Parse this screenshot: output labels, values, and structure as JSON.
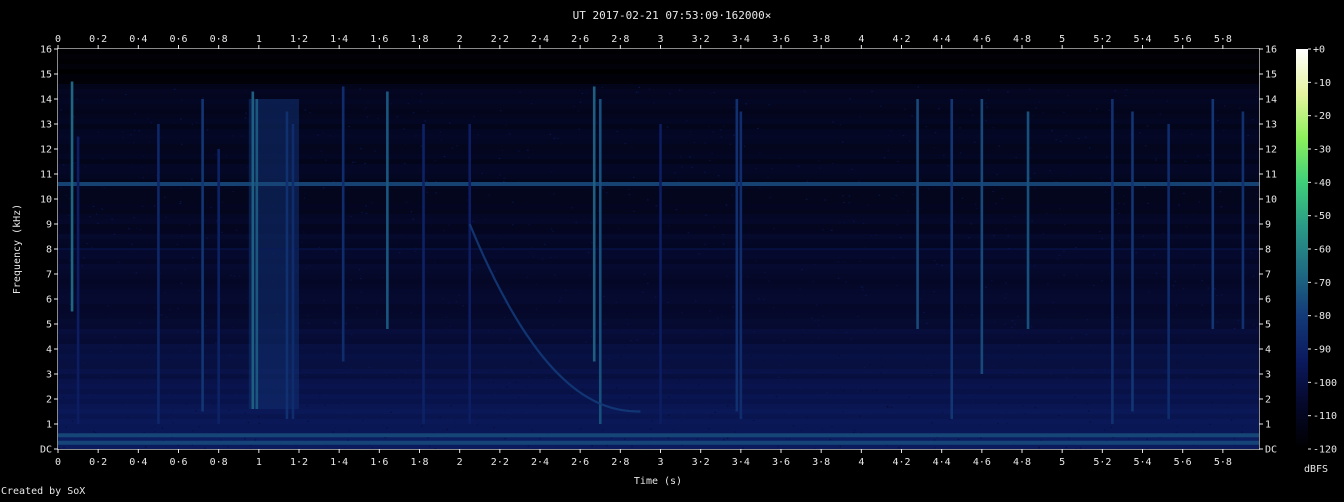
{
  "title": "UT 2017-02-21 07:53:09·162000×",
  "credit": "Created by SoX",
  "colors": {
    "background": "#000000",
    "text": "#e8e8e8",
    "frame": "#8a8a8a",
    "colormap": [
      "#000000",
      "#05082a",
      "#0b1a5e",
      "#133a78",
      "#1f6b82",
      "#2a9a86",
      "#3fd07a",
      "#8cf05c",
      "#e6f4a0",
      "#ffffff"
    ]
  },
  "chart_data": {
    "type": "heatmap",
    "title": "UT 2017-02-21 07:53:09·162000×",
    "xlabel": "Time (s)",
    "ylabel": "Frequency (kHz)",
    "xlim": [
      0,
      5.98
    ],
    "ylim": [
      0,
      16
    ],
    "x_ticks": [
      {
        "v": 0,
        "t": "0"
      },
      {
        "v": 0.2,
        "t": "0·2"
      },
      {
        "v": 0.4,
        "t": "0·4"
      },
      {
        "v": 0.6,
        "t": "0·6"
      },
      {
        "v": 0.8,
        "t": "0·8"
      },
      {
        "v": 1,
        "t": "1"
      },
      {
        "v": 1.2,
        "t": "1·2"
      },
      {
        "v": 1.4,
        "t": "1·4"
      },
      {
        "v": 1.6,
        "t": "1·6"
      },
      {
        "v": 1.8,
        "t": "1·8"
      },
      {
        "v": 2,
        "t": "2"
      },
      {
        "v": 2.2,
        "t": "2·2"
      },
      {
        "v": 2.4,
        "t": "2·4"
      },
      {
        "v": 2.6,
        "t": "2·6"
      },
      {
        "v": 2.8,
        "t": "2·8"
      },
      {
        "v": 3,
        "t": "3"
      },
      {
        "v": 3.2,
        "t": "3·2"
      },
      {
        "v": 3.4,
        "t": "3·4"
      },
      {
        "v": 3.6,
        "t": "3·6"
      },
      {
        "v": 3.8,
        "t": "3·8"
      },
      {
        "v": 4,
        "t": "4"
      },
      {
        "v": 4.2,
        "t": "4·2"
      },
      {
        "v": 4.4,
        "t": "4·4"
      },
      {
        "v": 4.6,
        "t": "4·6"
      },
      {
        "v": 4.8,
        "t": "4·8"
      },
      {
        "v": 5,
        "t": "5"
      },
      {
        "v": 5.2,
        "t": "5·2"
      },
      {
        "v": 5.4,
        "t": "5·4"
      },
      {
        "v": 5.6,
        "t": "5·6"
      },
      {
        "v": 5.8,
        "t": "5·8"
      }
    ],
    "y_ticks": [
      {
        "v": 0,
        "t": "DC"
      },
      {
        "v": 1,
        "t": "1"
      },
      {
        "v": 2,
        "t": "2"
      },
      {
        "v": 3,
        "t": "3"
      },
      {
        "v": 4,
        "t": "4"
      },
      {
        "v": 5,
        "t": "5"
      },
      {
        "v": 6,
        "t": "6"
      },
      {
        "v": 7,
        "t": "7"
      },
      {
        "v": 8,
        "t": "8"
      },
      {
        "v": 9,
        "t": "9"
      },
      {
        "v": 10,
        "t": "10"
      },
      {
        "v": 11,
        "t": "11"
      },
      {
        "v": 12,
        "t": "12"
      },
      {
        "v": 13,
        "t": "13"
      },
      {
        "v": 14,
        "t": "14"
      },
      {
        "v": 15,
        "t": "15"
      },
      {
        "v": 16,
        "t": "16"
      }
    ],
    "colorbar": {
      "label": "dBFS",
      "range": [
        -120,
        0
      ],
      "ticks": [
        {
          "v": 0,
          "t": "+0"
        },
        {
          "v": -10,
          "t": "-10"
        },
        {
          "v": -20,
          "t": "-20"
        },
        {
          "v": -30,
          "t": "-30"
        },
        {
          "v": -40,
          "t": "-40"
        },
        {
          "v": -50,
          "t": "-50"
        },
        {
          "v": -60,
          "t": "-60"
        },
        {
          "v": -70,
          "t": "-70"
        },
        {
          "v": -80,
          "t": "-80"
        },
        {
          "v": -90,
          "t": "-90"
        },
        {
          "v": -100,
          "t": "-100"
        },
        {
          "v": -110,
          "t": "-110"
        },
        {
          "v": -120,
          "t": "-120"
        }
      ]
    },
    "features": {
      "continuous_tones_khz": [
        10.6,
        8.0,
        0.55,
        0.25
      ],
      "vertical_impulses": [
        {
          "t": 0.07,
          "f0": 5.5,
          "f1": 14.7,
          "db": -68
        },
        {
          "t": 0.1,
          "f0": 1.0,
          "f1": 12.5,
          "db": -92
        },
        {
          "t": 0.5,
          "f0": 1.0,
          "f1": 13.0,
          "db": -88
        },
        {
          "t": 0.72,
          "f0": 1.5,
          "f1": 14.0,
          "db": -82
        },
        {
          "t": 0.8,
          "f0": 1.0,
          "f1": 12.0,
          "db": -90
        },
        {
          "t": 0.97,
          "f0": 1.6,
          "f1": 14.3,
          "db": -70
        },
        {
          "t": 0.99,
          "f0": 1.6,
          "f1": 14.0,
          "db": -72
        },
        {
          "t": 1.14,
          "f0": 1.2,
          "f1": 13.5,
          "db": -84
        },
        {
          "t": 1.17,
          "f0": 1.2,
          "f1": 13.0,
          "db": -86
        },
        {
          "t": 1.42,
          "f0": 3.5,
          "f1": 14.5,
          "db": -86
        },
        {
          "t": 1.64,
          "f0": 4.8,
          "f1": 14.3,
          "db": -72
        },
        {
          "t": 1.82,
          "f0": 1.0,
          "f1": 13.0,
          "db": -90
        },
        {
          "t": 2.05,
          "f0": 1.0,
          "f1": 13.0,
          "db": -92
        },
        {
          "t": 2.67,
          "f0": 3.5,
          "f1": 14.5,
          "db": -70
        },
        {
          "t": 2.7,
          "f0": 1.0,
          "f1": 14.0,
          "db": -74
        },
        {
          "t": 3.0,
          "f0": 1.0,
          "f1": 13.0,
          "db": -92
        },
        {
          "t": 3.38,
          "f0": 1.5,
          "f1": 14.0,
          "db": -84
        },
        {
          "t": 3.4,
          "f0": 1.2,
          "f1": 13.5,
          "db": -86
        },
        {
          "t": 4.28,
          "f0": 4.8,
          "f1": 14.0,
          "db": -76
        },
        {
          "t": 4.45,
          "f0": 1.2,
          "f1": 14.0,
          "db": -82
        },
        {
          "t": 4.6,
          "f0": 3.0,
          "f1": 14.0,
          "db": -76
        },
        {
          "t": 4.83,
          "f0": 4.8,
          "f1": 13.5,
          "db": -74
        },
        {
          "t": 5.25,
          "f0": 1.0,
          "f1": 14.0,
          "db": -84
        },
        {
          "t": 5.35,
          "f0": 1.5,
          "f1": 13.5,
          "db": -82
        },
        {
          "t": 5.53,
          "f0": 1.2,
          "f1": 13.0,
          "db": -86
        },
        {
          "t": 5.75,
          "f0": 4.8,
          "f1": 14.0,
          "db": -82
        },
        {
          "t": 5.9,
          "f0": 4.8,
          "f1": 13.5,
          "db": -84
        }
      ],
      "chirp": {
        "t0": 2.05,
        "t1": 2.9,
        "f0": 9.0,
        "f1": 1.5,
        "db": -80
      },
      "broadband_burst": {
        "t0": 0.95,
        "t1": 1.2,
        "f0": 1.6,
        "f1": 14.0,
        "db": -84
      }
    }
  }
}
